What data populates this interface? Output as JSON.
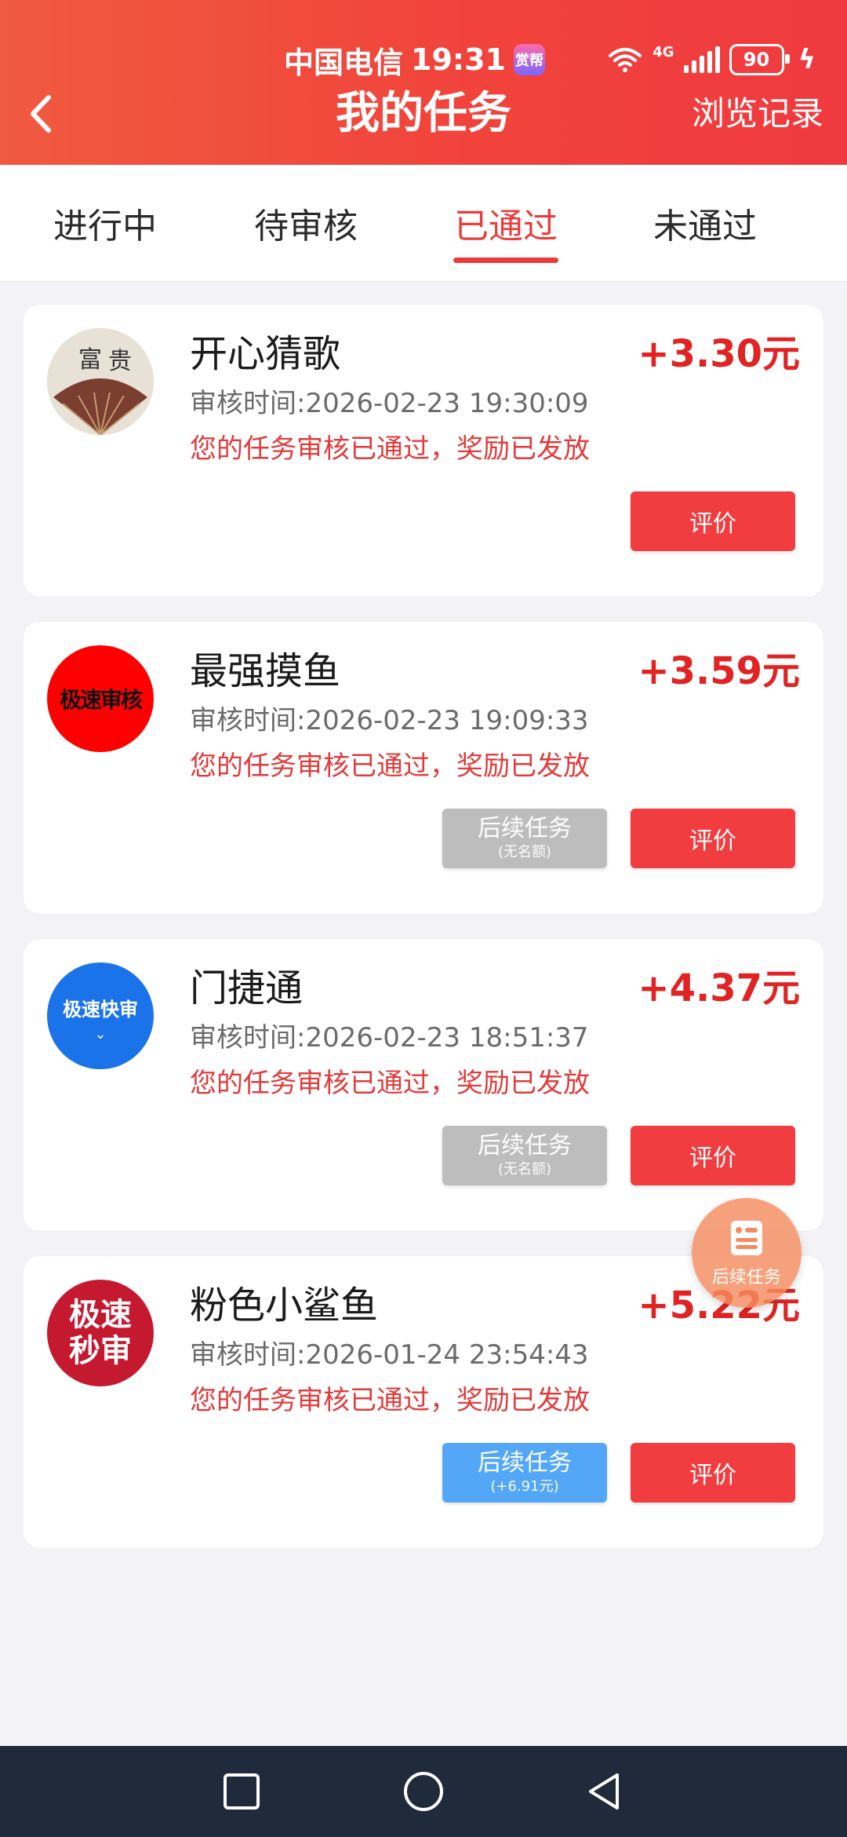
{
  "status_bar": {
    "carrier": "中国电信",
    "time": "19:31",
    "carrier_badge": "赏帮",
    "network": "4G",
    "battery": "90"
  },
  "header": {
    "title": "我的任务",
    "right_action": "浏览记录"
  },
  "tabs": [
    {
      "label": "进行中",
      "active": false
    },
    {
      "label": "待审核",
      "active": false
    },
    {
      "label": "已通过",
      "active": true
    },
    {
      "label": "未通过",
      "active": false
    }
  ],
  "tasks": [
    {
      "title": "开心猜歌",
      "reward": "+3.30元",
      "review_time": "审核时间:2026-02-23 19:30:09",
      "status": "您的任务审核已通过，奖励已发放",
      "avatar_text": "富 贵",
      "follow_button": null,
      "rate_button": "评价"
    },
    {
      "title": "最强摸鱼",
      "reward": "+3.59元",
      "review_time": "审核时间:2026-02-23 19:09:33",
      "status": "您的任务审核已通过，奖励已发放",
      "avatar_text": "极速审核",
      "follow_button": {
        "label": "后续任务",
        "sub": "(无名额)"
      },
      "rate_button": "评价"
    },
    {
      "title": "门捷通",
      "reward": "+4.37元",
      "review_time": "审核时间:2026-02-23 18:51:37",
      "status": "您的任务审核已通过，奖励已发放",
      "avatar_text": "极速快审",
      "follow_button": {
        "label": "后续任务",
        "sub": "(无名额)"
      },
      "rate_button": "评价"
    },
    {
      "title": "粉色小鲨鱼",
      "reward": "+5.22元",
      "review_time": "审核时间:2026-01-24 23:54:43",
      "status": "您的任务审核已通过，奖励已发放",
      "avatar_text": "极速秒审",
      "follow_button": {
        "label": "后续任务",
        "sub": "(+6.91元)"
      },
      "rate_button": "评价"
    }
  ],
  "fab": {
    "label": "后续任务"
  },
  "colors": {
    "primary": "#f1433c",
    "reward": "#e02323",
    "follow_disabled": "#bdbdbd",
    "follow_active": "#54a7f7"
  }
}
